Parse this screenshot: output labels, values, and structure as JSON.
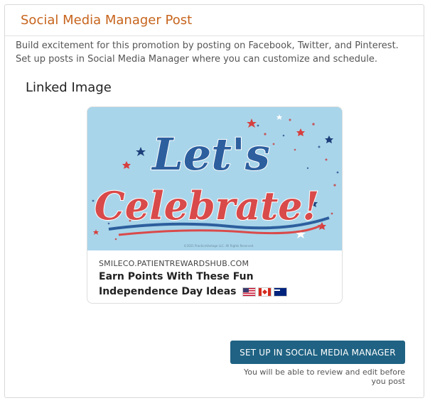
{
  "panel": {
    "title": "Social Media Manager Post",
    "description": "Build excitement for this promotion by posting on Facebook, Twitter, and Pinterest. Set up posts in Social Media Manager where you can customize and schedule."
  },
  "linked_image": {
    "section_title": "Linked Image",
    "image_text_line1": "Let's",
    "image_text_line2": "Celebrate!",
    "image_copyright": "©2021 PracticeVantage LLC. All Rights Reserved.",
    "domain": "SMILECO.PATIENTREWARDSHUB.COM",
    "title": "Earn Points With These Fun Independence Day Ideas",
    "flags": [
      "us-flag-icon",
      "canada-flag-icon",
      "australia-flag-icon"
    ]
  },
  "cta": {
    "button_label": "SET UP IN SOCIAL MEDIA MANAGER",
    "note": "You will be able to review and edit before you post"
  },
  "colors": {
    "title_orange": "#c7641c",
    "button_blue": "#1f6283",
    "image_background": "#a9d5ea"
  }
}
